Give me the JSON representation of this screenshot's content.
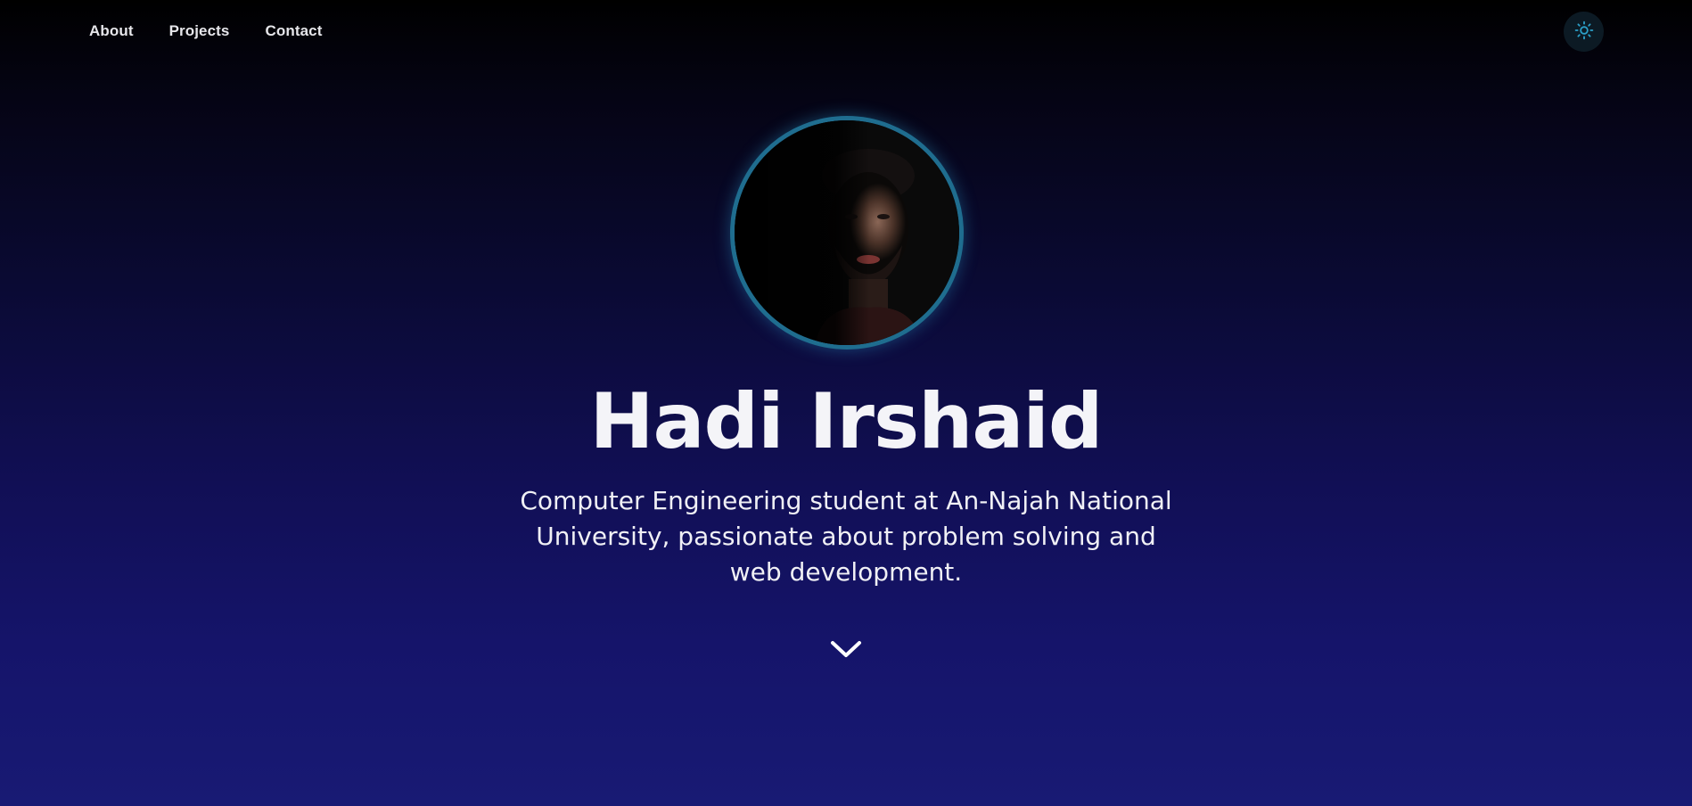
{
  "nav": {
    "links": [
      {
        "label": "About"
      },
      {
        "label": "Projects"
      },
      {
        "label": "Contact"
      }
    ],
    "theme_toggle_icon": "sun-icon"
  },
  "hero": {
    "avatar_icon": "profile-photo",
    "name": "Hadi Irshaid",
    "tagline": "Computer Engineering student at An-Najah National University, passionate about problem solving and web development.",
    "scroll_icon": "chevron-down-icon"
  },
  "colors": {
    "accent": "#1f6d8f",
    "toggle_icon": "#2b9fc7",
    "text": "#f4f4f8"
  }
}
